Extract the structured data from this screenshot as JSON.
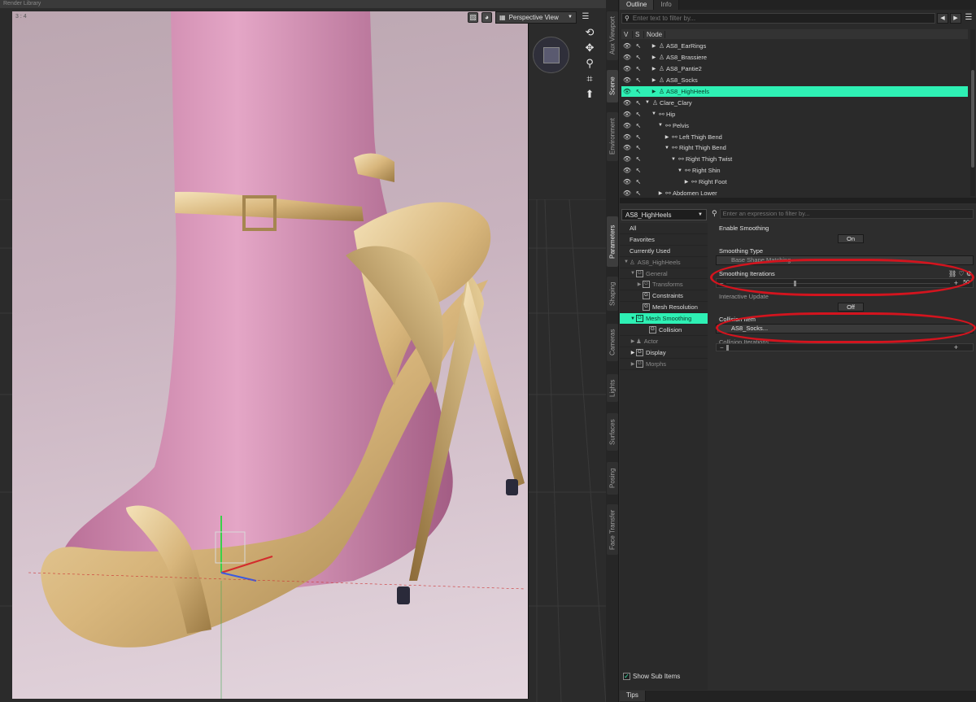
{
  "top_strip": {
    "library_tab": "Render Library"
  },
  "viewport": {
    "aspect_label": "3 : 4",
    "view_name": "Perspective View"
  },
  "side_tabs": [
    "Aux Viewport",
    "Scene",
    "Environment",
    "Parameters",
    "Shaping",
    "Cameras",
    "Lights",
    "Surfaces",
    "Posing",
    "Face Transfer"
  ],
  "scene": {
    "tabs": [
      "Outline",
      "Info"
    ],
    "filter_placeholder": "Enter text to filter by...",
    "columns": {
      "v": "V",
      "s": "S",
      "node": "Node"
    },
    "nodes": [
      {
        "label": "AS8_EarRings",
        "indent": 1,
        "expander": "▶",
        "icon": "figure",
        "selected": false
      },
      {
        "label": "AS8_Brassiere",
        "indent": 1,
        "expander": "▶",
        "icon": "figure",
        "selected": false
      },
      {
        "label": "AS8_Pantie2",
        "indent": 1,
        "expander": "▶",
        "icon": "figure",
        "selected": false
      },
      {
        "label": "AS8_Socks",
        "indent": 1,
        "expander": "▶",
        "icon": "figure",
        "selected": false
      },
      {
        "label": "AS8_HighHeels",
        "indent": 1,
        "expander": "▶",
        "icon": "figure",
        "selected": true
      },
      {
        "label": "Clare_Clary",
        "indent": 0,
        "expander": "▼",
        "icon": "figure",
        "selected": false
      },
      {
        "label": "Hip",
        "indent": 1,
        "expander": "▼",
        "icon": "bone",
        "selected": false
      },
      {
        "label": "Pelvis",
        "indent": 2,
        "expander": "▼",
        "icon": "bone",
        "selected": false
      },
      {
        "label": "Left Thigh Bend",
        "indent": 3,
        "expander": "▶",
        "icon": "bone",
        "selected": false
      },
      {
        "label": "Right Thigh Bend",
        "indent": 3,
        "expander": "▼",
        "icon": "bone",
        "selected": false
      },
      {
        "label": "Right Thigh Twist",
        "indent": 4,
        "expander": "▼",
        "icon": "bone",
        "selected": false
      },
      {
        "label": "Right Shin",
        "indent": 5,
        "expander": "▼",
        "icon": "bone",
        "selected": false
      },
      {
        "label": "Right Foot",
        "indent": 6,
        "expander": "▶",
        "icon": "bone",
        "selected": false
      },
      {
        "label": "Abdomen Lower",
        "indent": 2,
        "expander": "▶",
        "icon": "bone",
        "selected": false
      }
    ]
  },
  "parameters": {
    "node_select": "AS8_HighHeels",
    "filter_placeholder": "Enter an expression to filter by...",
    "tree": [
      {
        "label": "All",
        "indent": 0,
        "expander": "",
        "group": false,
        "dim": false,
        "selected": false
      },
      {
        "label": "Favorites",
        "indent": 0,
        "expander": "",
        "group": false,
        "dim": false,
        "selected": false
      },
      {
        "label": "Currently Used",
        "indent": 0,
        "expander": "",
        "group": false,
        "dim": false,
        "selected": false
      },
      {
        "label": "AS8_HighHeels",
        "indent": 0,
        "expander": "▼",
        "group": false,
        "dim": true,
        "selected": false
      },
      {
        "label": "General",
        "indent": 1,
        "expander": "▼",
        "group": true,
        "dim": true,
        "selected": false
      },
      {
        "label": "Transforms",
        "indent": 2,
        "expander": "▶",
        "group": true,
        "dim": true,
        "selected": false
      },
      {
        "label": "Constraints",
        "indent": 2,
        "expander": "",
        "group": true,
        "dim": false,
        "selected": false
      },
      {
        "label": "Mesh Resolution",
        "indent": 2,
        "expander": "",
        "group": true,
        "dim": false,
        "selected": false
      },
      {
        "label": "Mesh Smoothing",
        "indent": 1,
        "expander": "▼",
        "group": true,
        "dim": false,
        "selected": true
      },
      {
        "label": "Collision",
        "indent": 3,
        "expander": "",
        "group": true,
        "dim": false,
        "selected": false
      },
      {
        "label": "Actor",
        "indent": 1,
        "expander": "▶",
        "group": false,
        "dim": true,
        "selected": false
      },
      {
        "label": "Display",
        "indent": 1,
        "expander": "▶",
        "group": true,
        "dim": false,
        "selected": false
      },
      {
        "label": "Morphs",
        "indent": 1,
        "expander": "▶",
        "group": true,
        "dim": true,
        "selected": false
      }
    ],
    "show_sub_items": "Show Sub Items",
    "params": {
      "enable_smoothing": {
        "label": "Enable Smoothing",
        "value": "On"
      },
      "smoothing_type": {
        "label": "Smoothing Type",
        "value": "Base Shape Matching"
      },
      "smoothing_iterations": {
        "label": "Smoothing Iterations",
        "value": "50",
        "level": 0.3
      },
      "interactive_update": {
        "label": "Interactive Update",
        "value": "Off"
      },
      "collision_item": {
        "label": "Collision Item",
        "value": "AS8_Socks..."
      },
      "collision_iterations": {
        "label": "Collision Iterations",
        "level": 0.0
      }
    }
  },
  "tips_tab": "Tips",
  "colors": {
    "selection": "#2ef0b4",
    "annotation": "#d3141e"
  }
}
